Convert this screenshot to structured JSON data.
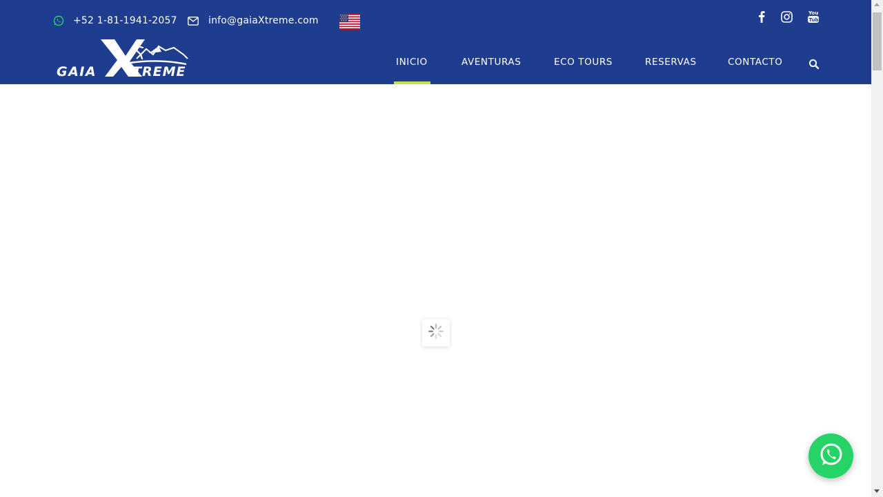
{
  "topbar": {
    "phone": "+52 1-81-1941-2057",
    "email": "info@gaiaXtreme.com",
    "phone_icon": "whatsapp-icon",
    "email_icon": "envelope-icon",
    "language_flag": "us-flag-icon",
    "social": [
      "facebook-icon",
      "instagram-icon",
      "youtube-icon"
    ]
  },
  "logo": {
    "text_left": "GAIA",
    "text_x": "X",
    "text_right": "TREME"
  },
  "nav": {
    "items": [
      {
        "label": "INICIO",
        "active": true
      },
      {
        "label": "AVENTURAS",
        "active": false
      },
      {
        "label": "ECO TOURS",
        "active": false
      },
      {
        "label": "RESERVAS",
        "active": false
      },
      {
        "label": "CONTACTO",
        "active": false
      }
    ],
    "search_icon": "search-icon"
  },
  "main": {
    "loader_icon": "spinner-icon"
  },
  "floating": {
    "whatsapp_icon": "whatsapp-icon"
  },
  "colors": {
    "header_bg": "#1e3d8f",
    "active_underline": "#c6e04a",
    "whatsapp_green": "#25d366"
  }
}
